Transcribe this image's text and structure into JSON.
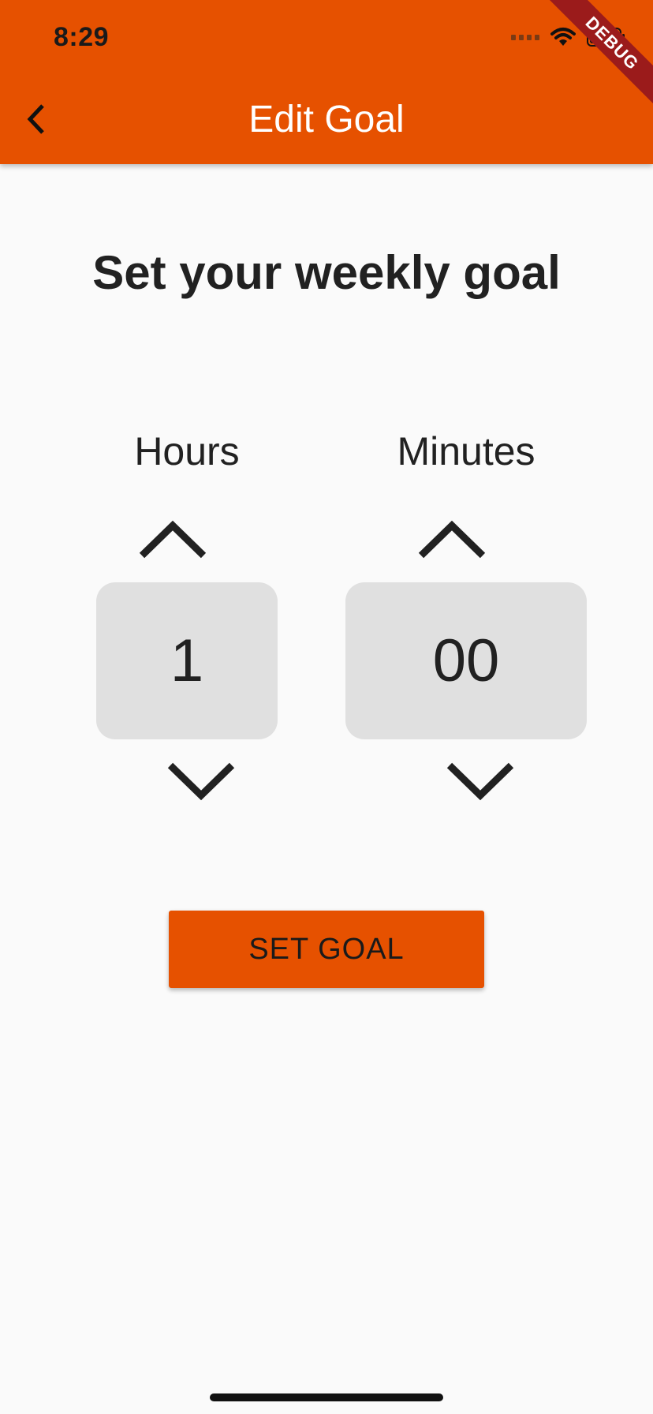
{
  "status_bar": {
    "time": "8:29"
  },
  "app_bar": {
    "title": "Edit Goal",
    "background_color": "#e65100",
    "title_color": "#ffffff"
  },
  "debug_banner": {
    "label": "DEBUG"
  },
  "main": {
    "heading": "Set your weekly goal",
    "pickers": [
      {
        "label": "Hours",
        "value": "1"
      },
      {
        "label": "Minutes",
        "value": "00"
      }
    ],
    "set_goal_label": "SET GOAL",
    "accent_color": "#e65100",
    "value_box_color": "#e0e0e0"
  },
  "icons": {
    "back": "chevron-left-icon",
    "increment": "chevron-up-icon",
    "decrement": "chevron-down-icon",
    "wifi": "wifi-icon",
    "battery": "battery-icon",
    "signal": "cellular-signal-icon"
  }
}
